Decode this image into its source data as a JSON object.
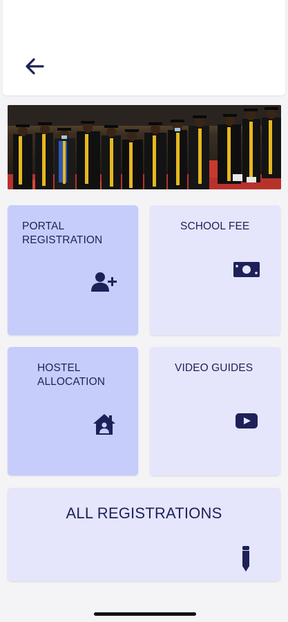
{
  "header": {
    "back_icon": "arrow-left-icon"
  },
  "banner": {
    "image_description": "graduation-ceremony-photo"
  },
  "tiles": {
    "portal_registration": {
      "label": "PORTAL\nREGISTRATION",
      "icon": "add-user-icon"
    },
    "school_fee": {
      "label": "SCHOOL FEE",
      "icon": "money-bill-icon"
    },
    "hostel_allocation": {
      "label": "HOSTEL\nALLOCATION",
      "icon": "house-user-icon"
    },
    "video_guides": {
      "label": "VIDEO GUIDES",
      "icon": "youtube-play-icon"
    },
    "all_registrations": {
      "label": "ALL REGISTRATIONS",
      "icon": "pencil-icon"
    }
  },
  "colors": {
    "accent": "#1e2157",
    "tile_blue": "#c6cdfb",
    "tile_pale": "#e5e6fc",
    "background": "#f4f4f6"
  }
}
